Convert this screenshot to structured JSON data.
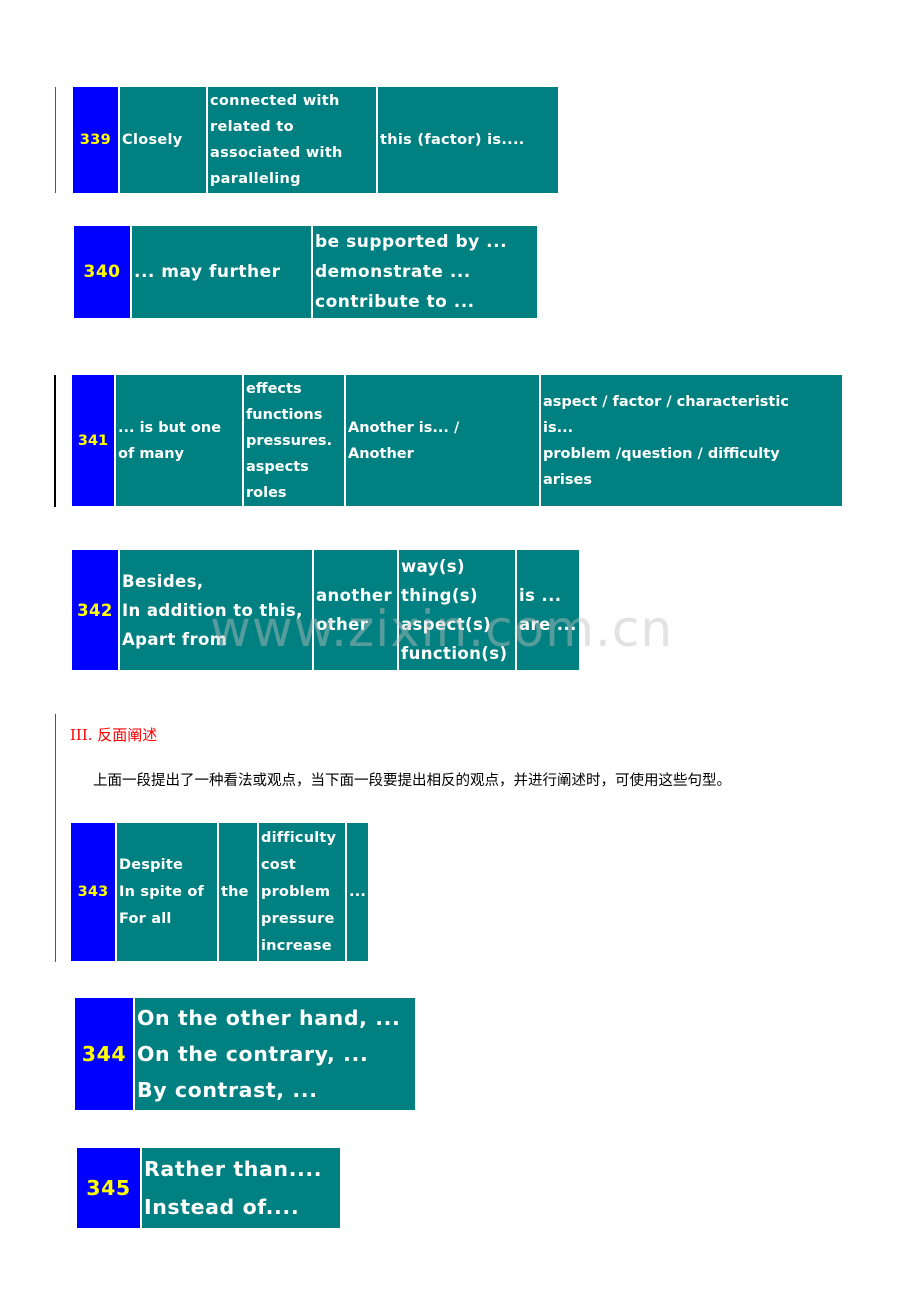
{
  "document": {
    "watermark": "www.zixin.com.cn",
    "section_heading": "III. 反面阐述",
    "section_intro": "上面一段提出了一种看法或观点，当下面一段要提出相反的观点，并进行阐述时，可使用这些句型。",
    "colors": {
      "number_cell_bg": "#0000ff",
      "number_text": "#ffff00",
      "phrase_cell_bg": "#008080",
      "phrase_text": "#ffffff",
      "heading_text": "#ff0000"
    },
    "phrase_tables": [
      {
        "number": "339",
        "columns": [
          [
            "Closely"
          ],
          [
            "connected with",
            "related to",
            "associated with",
            "paralleling"
          ],
          [
            "this (factor) is...."
          ]
        ]
      },
      {
        "number": "340",
        "columns": [
          [
            "... may further"
          ],
          [
            "be supported by ...",
            "demonstrate ...",
            "contribute to ..."
          ]
        ]
      },
      {
        "number": "341",
        "columns": [
          [
            "... is but one",
            "of many"
          ],
          [
            "effects",
            "functions",
            "pressures.",
            "aspects",
            "roles"
          ],
          [
            "Another is... /",
            "Another"
          ],
          [
            "aspect / factor / characteristic",
            "is...",
            "problem /question / difficulty",
            "arises"
          ]
        ]
      },
      {
        "number": "342",
        "columns": [
          [
            "Besides,",
            "In addition to this,",
            "Apart from"
          ],
          [
            "another",
            "other"
          ],
          [
            "way(s)",
            "thing(s)",
            "aspect(s)",
            "function(s)"
          ],
          [
            "is ...",
            "are ..."
          ]
        ]
      },
      {
        "number": "343",
        "columns": [
          [
            "Despite",
            "In spite of",
            "For all"
          ],
          [
            "the"
          ],
          [
            "difficulty",
            "cost",
            "problem",
            "pressure",
            "increase"
          ],
          [
            "..."
          ]
        ]
      },
      {
        "number": "344",
        "columns": [
          [
            "On the other hand, ...",
            "On the contrary, ...",
            "By contrast, ..."
          ]
        ]
      },
      {
        "number": "345",
        "columns": [
          [
            "Rather than....",
            "Instead of...."
          ]
        ]
      }
    ]
  }
}
